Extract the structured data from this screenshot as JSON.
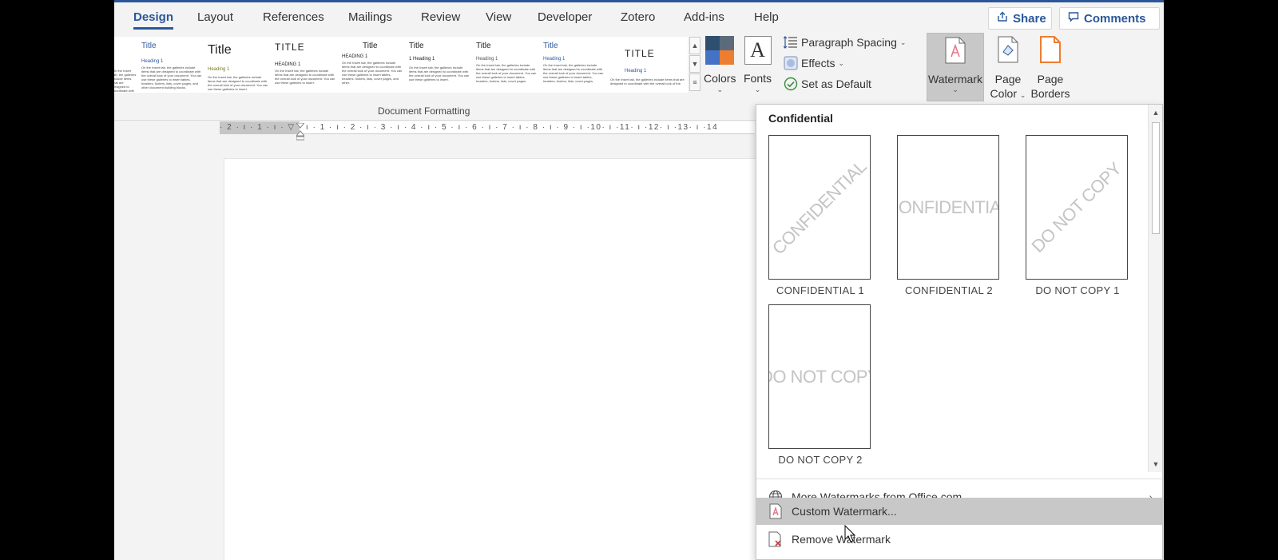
{
  "tabs": [
    {
      "label": "Design",
      "active": true
    },
    {
      "label": "Layout"
    },
    {
      "label": "References"
    },
    {
      "label": "Mailings"
    },
    {
      "label": "Review"
    },
    {
      "label": "View"
    },
    {
      "label": "Developer"
    },
    {
      "label": "Zotero"
    },
    {
      "label": "Add-ins"
    },
    {
      "label": "Help"
    }
  ],
  "topbar": {
    "share": "Share",
    "comments": "Comments"
  },
  "gallery": {
    "items": [
      {
        "title": "",
        "heading": "",
        "body": "On the Insert tab, the galleries include items that are designed to coordinate with the overall look of your document."
      },
      {
        "title": "Title",
        "heading": "Heading 1",
        "body": "On the Insert tab, the galleries include items that are designed to coordinate with the overall look of your document. You can use these galleries to insert tables, headers, footers, lists, cover pages, and other document building blocks."
      },
      {
        "title": "Title",
        "heading": "Heading 1",
        "body": "On the Insert tab, the galleries include items that are designed to coordinate with the overall look of your document. You can use these galleries to insert."
      },
      {
        "title": "TITLE",
        "heading": "HEADING 1",
        "body": "On the Insert tab, the galleries include items that are designed to coordinate with the overall look of your document. You can use these galleries to insert."
      },
      {
        "title": "Title",
        "heading": "HEADING 1",
        "body": "On the Insert tab, the galleries include items that are designed to coordinate with the overall look of your document. You can use these galleries to insert tables, headers, footers, lists, cover pages, and other."
      },
      {
        "title": "Title",
        "heading": "1 Heading 1",
        "body": "On the Insert tab, the galleries include items that are designed to coordinate with the overall look of your document. You can use these galleries to insert."
      },
      {
        "title": "Title",
        "heading": "Heading 1",
        "body": "On the Insert tab, the galleries include items that are designed to coordinate with the overall look of your document. You can use these galleries to insert tables, headers, footers, lists, cover pages."
      },
      {
        "title": "Title",
        "heading": "Heading 1",
        "body": "On the Insert tab, the galleries include items that are designed to coordinate with the overall look of your document. You can use these galleries to insert tables, headers, footers, lists, cover pages."
      },
      {
        "title": "TITLE",
        "heading": "Heading 1",
        "body": "On the Insert tab, the galleries include items that are designed to coordinate with the overall look of the."
      }
    ],
    "group_label": "Document Formatting"
  },
  "ribbon": {
    "colors": "Colors",
    "fonts": "Fonts",
    "fonts_glyph": "A",
    "paragraph_spacing": "Paragraph Spacing",
    "effects": "Effects",
    "set_as_default": "Set as Default",
    "watermark": "Watermark",
    "page_color_1": "Page",
    "page_color_2": "Color",
    "page_borders_1": "Page",
    "page_borders_2": "Borders"
  },
  "ruler": {
    "labels": "· 2 · ı · 1 · ı · ▽ · ı · 1 · ı · 2 · ı · 3 · ı · 4 · ı · 5 · ı · 6 · ı · 7 · ı · 8 · ı · 9 · ı ·10· ı ·11· ı ·12· ı ·13· ı ·14"
  },
  "watermark_menu": {
    "section": "Confidential",
    "items": [
      {
        "caption": "CONFIDENTIAL 1",
        "text": "CONFIDENTIAL"
      },
      {
        "caption": "CONFIDENTIAL 2",
        "text": "CONFIDENTIAL"
      },
      {
        "caption": "DO NOT COPY 1",
        "text": "DO NOT COPY"
      },
      {
        "caption": "DO NOT COPY 2",
        "text": "DO NOT COPY"
      }
    ],
    "more": "More Watermarks from Office.com",
    "custom": "Custom Watermark...",
    "remove": "Remove Watermark"
  },
  "colors": {
    "accent": "#2b579a",
    "swatch": [
      "#2f4f6f",
      "#4a5a6a",
      "#4472c4",
      "#ed7d31"
    ],
    "orange": "#ed7d31"
  }
}
